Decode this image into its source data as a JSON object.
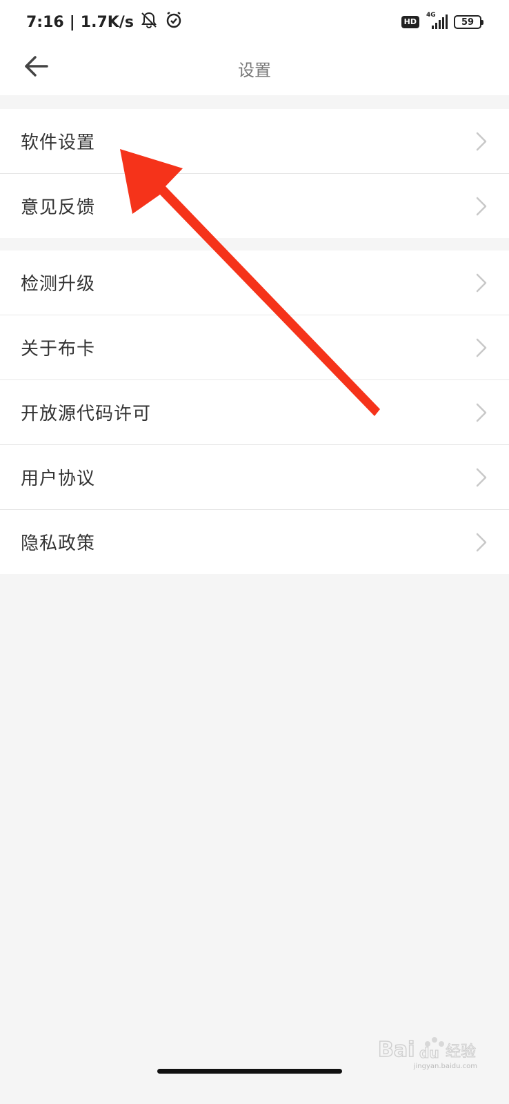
{
  "status_bar": {
    "time": "7:16",
    "separator": "|",
    "network_speed": "1.7K/s",
    "icons_left": [
      "mute-bell-icon",
      "alarm-icon"
    ],
    "hd_badge": "HD",
    "network_type": "4G",
    "battery_level": "59"
  },
  "header": {
    "back_icon": "arrow-left-icon",
    "title": "设置"
  },
  "settings": {
    "group1": [
      {
        "label": "软件设置"
      },
      {
        "label": "意见反馈"
      }
    ],
    "group2": [
      {
        "label": "检测升级"
      },
      {
        "label": "关于布卡"
      },
      {
        "label": "开放源代码许可"
      },
      {
        "label": "用户协议"
      },
      {
        "label": "隐私政策"
      }
    ]
  },
  "annotation": {
    "arrow_color": "#f5331a",
    "points_to": "软件设置"
  },
  "watermark": {
    "text": "jingyan.baidu.com"
  }
}
